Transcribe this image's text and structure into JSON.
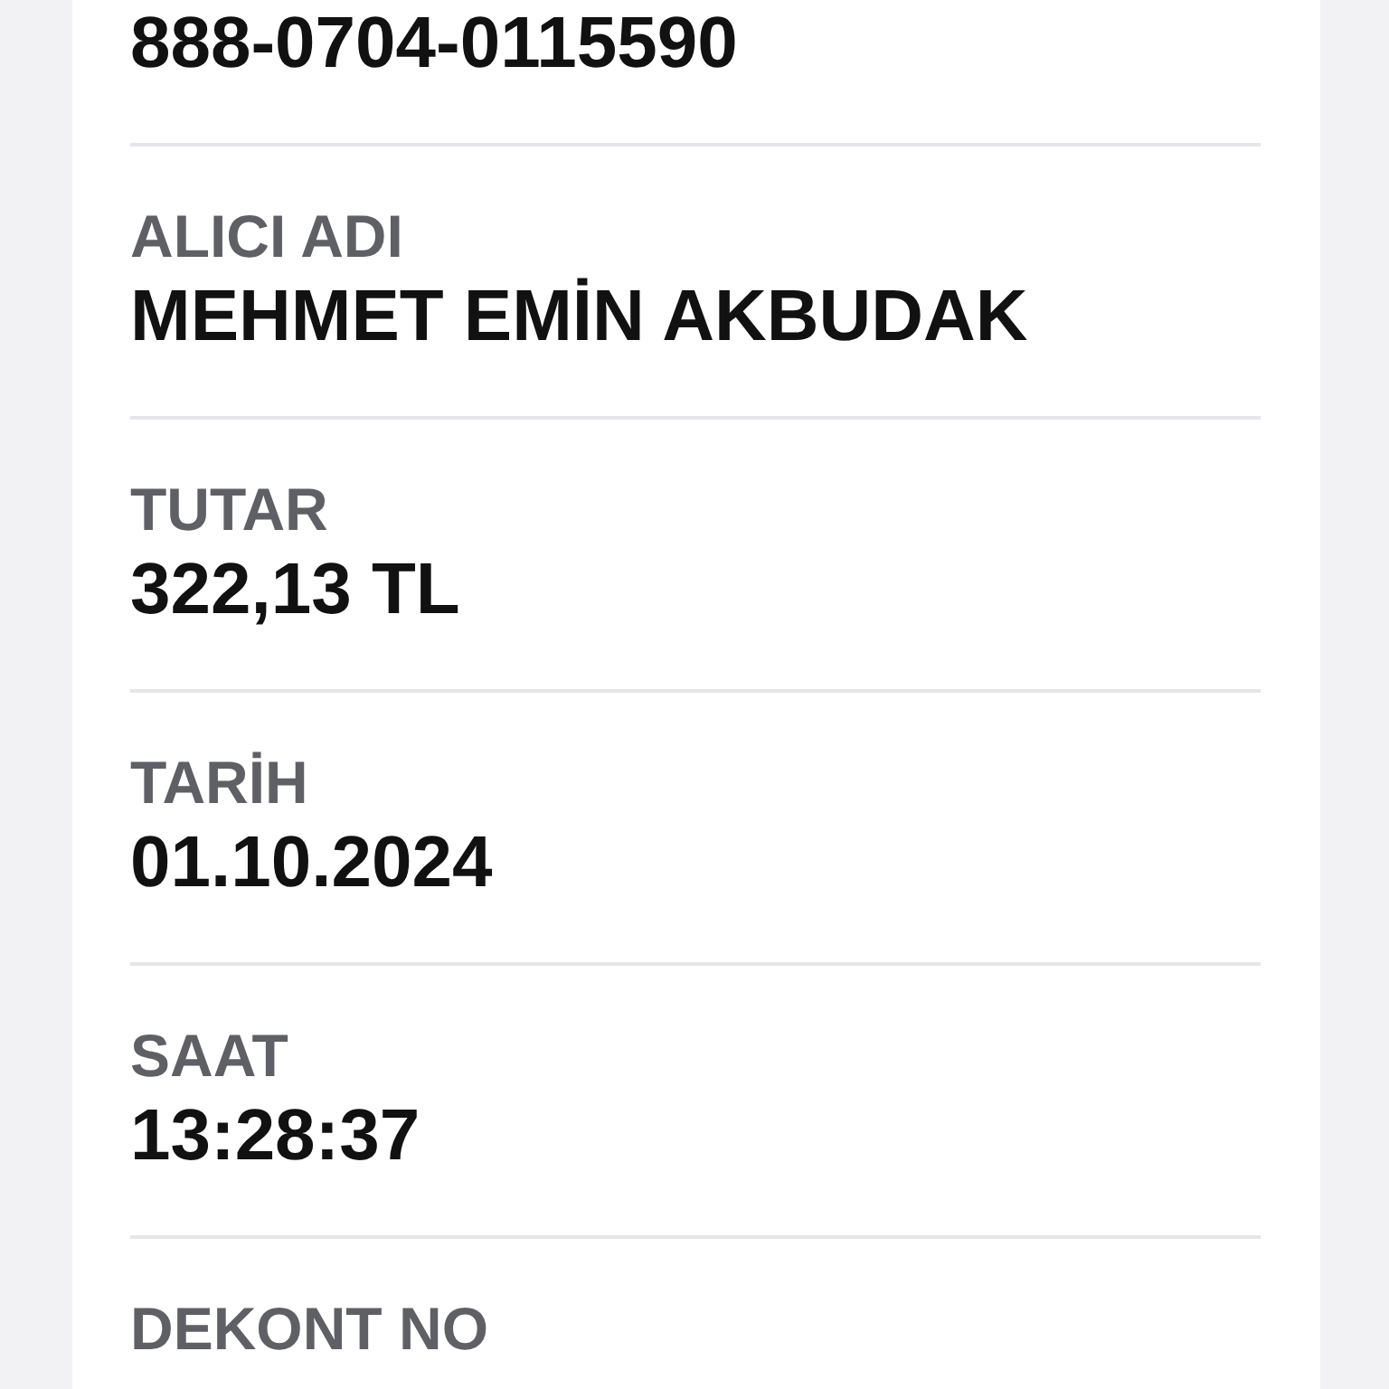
{
  "top_value": "888-0704-0115590",
  "fields": [
    {
      "label": "ALICI ADI",
      "value": "MEHMET EMİN AKBUDAK"
    },
    {
      "label": "TUTAR",
      "value": "322,13 TL"
    },
    {
      "label": "TARİH",
      "value": "01.10.2024"
    },
    {
      "label": "SAAT",
      "value": "13:28:37"
    },
    {
      "label": "DEKONT NO"
    }
  ]
}
